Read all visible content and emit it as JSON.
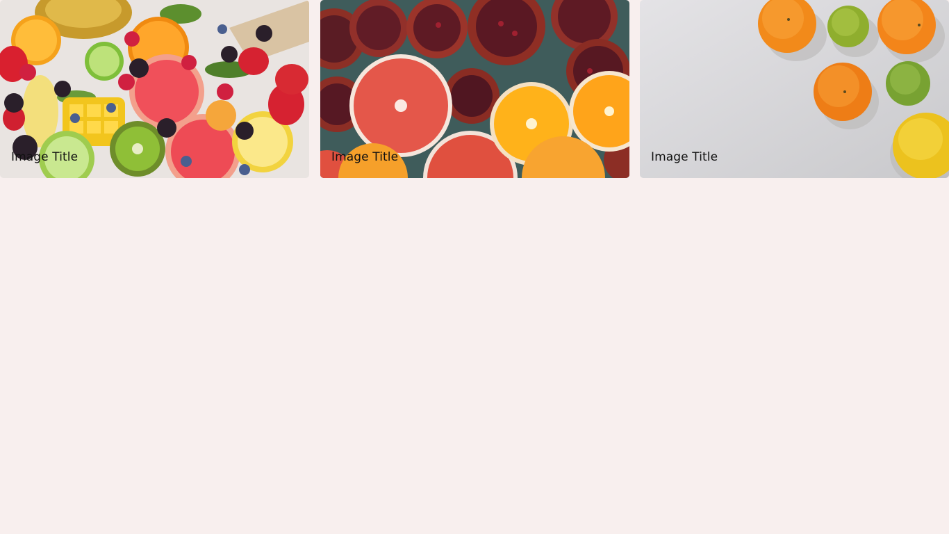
{
  "page": {
    "background": "#f8efee"
  },
  "gallery": {
    "cards": [
      {
        "title": "Image Title",
        "image": "fruit-platter-photo"
      },
      {
        "title": "Image Title",
        "image": "grapefruit-pomegranate-oranges-photo"
      },
      {
        "title": "Image Title",
        "image": "citrus-on-white-photo"
      }
    ]
  }
}
